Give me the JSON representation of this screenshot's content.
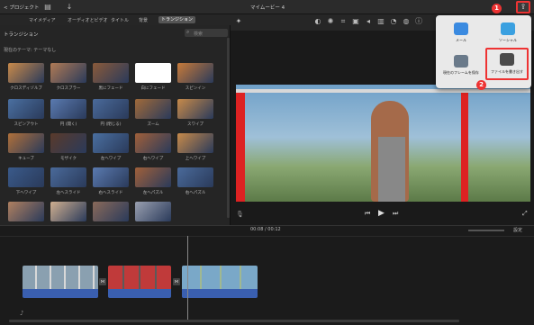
{
  "topbar": {
    "back_label": "< プロジェクト",
    "title": "マイムービー 4"
  },
  "subbar": {
    "tabs": [
      "マイメディア",
      "オーディオとビデオ",
      "タイトル",
      "背景",
      "トランジション"
    ],
    "active_tab": "トランジション"
  },
  "browser": {
    "heading": "トランジション",
    "search_placeholder": "検索",
    "theme_label": "現在のテーマ: テーマなし",
    "items": [
      {
        "label": "クロスディゾルブ",
        "color": "#c98a4a"
      },
      {
        "label": "クロスブラー",
        "color": "#b07a55"
      },
      {
        "label": "黒にフェード",
        "color": "#8a5a3a"
      },
      {
        "label": "白にフェード",
        "color": "#ffffff"
      },
      {
        "label": "スピンイン",
        "color": "#c77a3a"
      },
      {
        "label": "スピンアウト",
        "color": "#4a6fa0"
      },
      {
        "label": "円 (開く)",
        "color": "#5a7ab0"
      },
      {
        "label": "円 (閉じる)",
        "color": "#4a6a9a"
      },
      {
        "label": "ズーム",
        "color": "#a06a3a"
      },
      {
        "label": "スワイプ",
        "color": "#c78a4a"
      },
      {
        "label": "キューブ",
        "color": "#b0703a"
      },
      {
        "label": "モザイク",
        "color": "#5a3a2a"
      },
      {
        "label": "左へワイプ",
        "color": "#4a6fa0"
      },
      {
        "label": "右へワイプ",
        "color": "#a0603a"
      },
      {
        "label": "上へワイプ",
        "color": "#c78a4a"
      },
      {
        "label": "下へワイプ",
        "color": "#3a5a8a"
      },
      {
        "label": "左へスライド",
        "color": "#4a6a9a"
      },
      {
        "label": "右へスライド",
        "color": "#5a7ab0"
      },
      {
        "label": "左へパズル",
        "color": "#a0603a"
      },
      {
        "label": "右へパズル",
        "color": "#4a6a9a"
      },
      {
        "label": "",
        "color": "#b08060"
      },
      {
        "label": "",
        "color": "#d0b090"
      },
      {
        "label": "",
        "color": "#8a6a5a"
      },
      {
        "label": "",
        "color": "#9aa0b0"
      }
    ]
  },
  "share_popup": {
    "items": [
      {
        "label": "メール",
        "color": "#3a8ae0"
      },
      {
        "label": "ソーシャル",
        "color": "#3aa0e0"
      },
      {
        "label": "現在のフレームを保存",
        "color": "#6a7a8a"
      },
      {
        "label": "ファイルを書き出す",
        "color": "#4a4a4a"
      }
    ],
    "badge1": "1",
    "badge2": "2"
  },
  "timeline": {
    "time_current": "00:08",
    "time_total": "00:12",
    "settings_label": "設定"
  },
  "colors": {
    "accent_red": "#e33333",
    "clip_blue": "#3a5fb0"
  }
}
